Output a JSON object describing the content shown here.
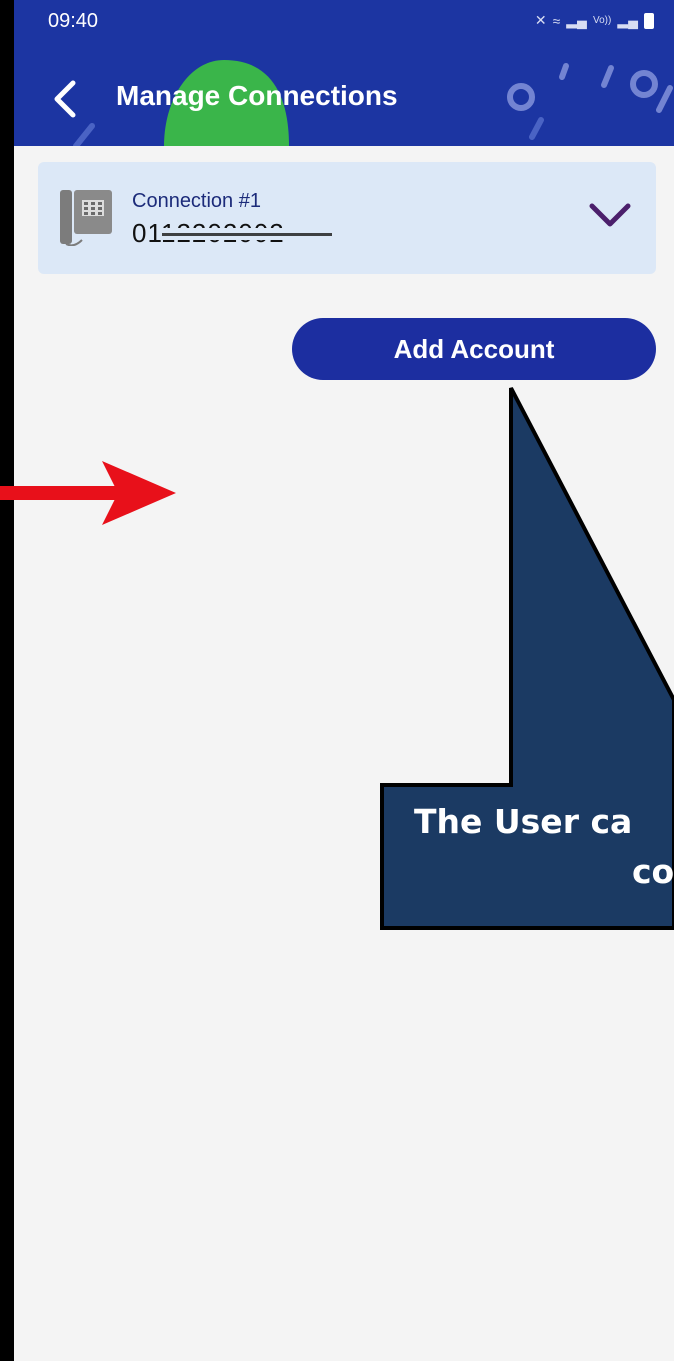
{
  "status_bar": {
    "time": "09:40",
    "icons": [
      "mute-icon",
      "wifi-icon",
      "signal-icon",
      "volte-icon",
      "signal-icon",
      "battery-icon"
    ],
    "volte_text": "Vo))"
  },
  "header": {
    "title": "Manage Connections",
    "background": "#1c35a2",
    "accent": "#3ab54a"
  },
  "connection": {
    "label": "Connection #1",
    "number": "0112202002"
  },
  "actions": {
    "add_account": "Add Account"
  },
  "annotation": {
    "line1": "The User ca",
    "line2": "co",
    "box_color": "#1b3a63",
    "arrow_color": "#e8101a"
  }
}
